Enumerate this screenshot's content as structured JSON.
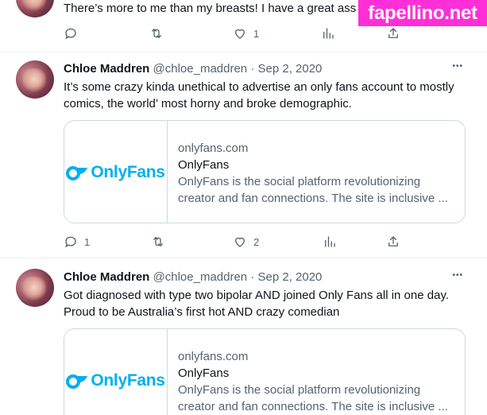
{
  "watermark": "fapellino.net",
  "tweet0": {
    "text": "There’s more to me than my breasts! I have a great ass",
    "likes": "1"
  },
  "tweet1": {
    "name": "Chloe Maddren",
    "handle": "@chloe_maddren",
    "sep": "·",
    "date": "Sep 2, 2020",
    "more": "•••",
    "text": "It’s some crazy kinda unethical to advertise an only fans account to mostly comics, the world’ most horny and broke demographic.",
    "card": {
      "logo": "OnlyFans",
      "domain": "onlyfans.com",
      "title": "OnlyFans",
      "desc": "OnlyFans is the social platform revolutionizing creator and fan connections. The site is inclusive ..."
    },
    "replies": "1",
    "likes": "2"
  },
  "tweet2": {
    "name": "Chloe Maddren",
    "handle": "@chloe_maddren",
    "sep": "·",
    "date": "Sep 2, 2020",
    "more": "•••",
    "text": "Got diagnosed with type two bipolar AND joined Only Fans all in one day. Proud to be Australia’s first hot AND crazy comedian",
    "card": {
      "logo": "OnlyFans",
      "domain": "onlyfans.com",
      "title": "OnlyFans",
      "desc": "OnlyFans is the social platform revolutionizing creator and fan connections. The site is inclusive ..."
    }
  },
  "colors": {
    "accent": "#00aff0",
    "muted": "#536471",
    "watermark_bg": "#ff2fd8"
  },
  "icons": [
    "reply-icon",
    "retweet-icon",
    "like-icon",
    "views-icon",
    "share-icon",
    "more-icon"
  ]
}
